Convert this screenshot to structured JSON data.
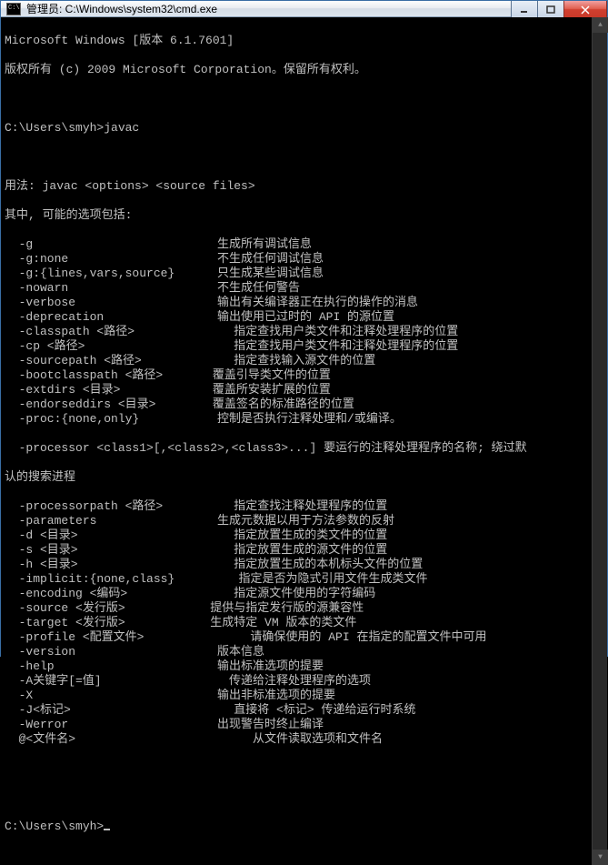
{
  "titlebar": {
    "text": "管理员: C:\\Windows\\system32\\cmd.exe"
  },
  "banner": {
    "line1": "Microsoft Windows [版本 6.1.7601]",
    "line2": "版权所有 (c) 2009 Microsoft Corporation。保留所有权利。"
  },
  "prompt1": {
    "path": "C:\\Users\\smyh>",
    "cmd": "javac"
  },
  "usage": {
    "label": "用法: ",
    "text": "javac <options> <source files>"
  },
  "options_header": "其中, 可能的选项包括:",
  "options": [
    {
      "flag": "-g",
      "desc": "生成所有调试信息"
    },
    {
      "flag": "-g:none",
      "desc": "不生成任何调试信息"
    },
    {
      "flag": "-g:{lines,vars,source}",
      "desc": "只生成某些调试信息"
    },
    {
      "flag": "-nowarn",
      "desc": "不生成任何警告"
    },
    {
      "flag": "-verbose",
      "desc": "输出有关编译器正在执行的操作的消息"
    },
    {
      "flag": "-deprecation",
      "desc": "输出使用已过时的 API 的源位置"
    },
    {
      "flag": "-classpath <路径>",
      "desc": "指定查找用户类文件和注释处理程序的位置"
    },
    {
      "flag": "-cp <路径>",
      "desc": "指定查找用户类文件和注释处理程序的位置"
    },
    {
      "flag": "-sourcepath <路径>",
      "desc": "指定查找输入源文件的位置"
    },
    {
      "flag": "-bootclasspath <路径>",
      "desc": "覆盖引导类文件的位置"
    },
    {
      "flag": "-extdirs <目录>",
      "desc": "覆盖所安装扩展的位置"
    },
    {
      "flag": "-endorseddirs <目录>",
      "desc": "覆盖签名的标准路径的位置"
    },
    {
      "flag": "-proc:{none,only}",
      "desc": "控制是否执行注释处理和/或编译。"
    }
  ],
  "processor": {
    "flag": "-processor <class1>[,<class2>,<class3>...] 要运行的注释处理程序的名称; 绕过默",
    "cont": "认的搜索进程"
  },
  "options2": [
    {
      "flag": "-processorpath <路径>",
      "desc": "指定查找注释处理程序的位置"
    },
    {
      "flag": "-parameters",
      "desc": "生成元数据以用于方法参数的反射"
    },
    {
      "flag": "-d <目录>",
      "desc": "指定放置生成的类文件的位置"
    },
    {
      "flag": "-s <目录>",
      "desc": "指定放置生成的源文件的位置"
    },
    {
      "flag": "-h <目录>",
      "desc": "指定放置生成的本机标头文件的位置"
    },
    {
      "flag": "-implicit:{none,class}",
      "desc": "指定是否为隐式引用文件生成类文件"
    },
    {
      "flag": "-encoding <编码>",
      "desc": "指定源文件使用的字符编码"
    },
    {
      "flag": "-source <发行版>",
      "desc": "提供与指定发行版的源兼容性"
    },
    {
      "flag": "-target <发行版>",
      "desc": "生成特定 VM 版本的类文件"
    },
    {
      "flag": "-profile <配置文件>",
      "desc": "请确保使用的 API 在指定的配置文件中可用"
    },
    {
      "flag": "-version",
      "desc": "版本信息"
    },
    {
      "flag": "-help",
      "desc": "输出标准选项的提要"
    },
    {
      "flag": "-A关键字[=值]",
      "desc": "传递给注释处理程序的选项"
    },
    {
      "flag": "-X",
      "desc": "输出非标准选项的提要"
    },
    {
      "flag": "-J<标记>",
      "desc": "直接将 <标记> 传递给运行时系统"
    },
    {
      "flag": "-Werror",
      "desc": "出现警告时终止编译"
    },
    {
      "flag": "@<文件名>",
      "desc": "从文件读取选项和文件名"
    }
  ],
  "prompt2": {
    "path": "C:\\Users\\smyh>"
  }
}
